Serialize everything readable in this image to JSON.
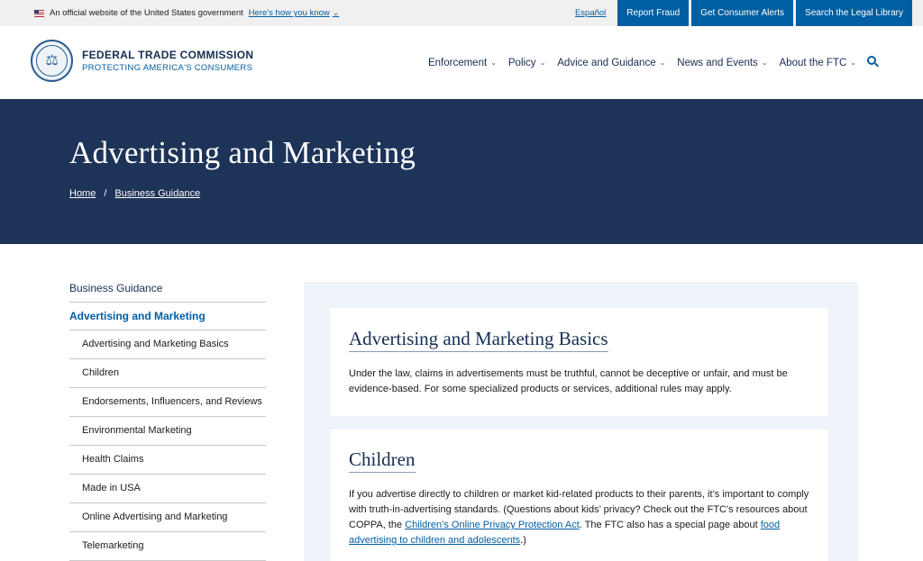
{
  "gov_banner": {
    "official_text": "An official website of the United States government",
    "how_you_know": "Here's how you know",
    "espanol": "Español",
    "buttons": [
      "Report Fraud",
      "Get Consumer Alerts",
      "Search the Legal Library"
    ]
  },
  "header": {
    "org_name": "FEDERAL TRADE COMMISSION",
    "org_tagline": "PROTECTING AMERICA'S CONSUMERS",
    "nav": [
      "Enforcement",
      "Policy",
      "Advice and Guidance",
      "News and Events",
      "About the FTC"
    ]
  },
  "hero": {
    "title": "Advertising and Marketing",
    "breadcrumb": [
      "Home",
      "Business Guidance"
    ],
    "breadcrumb_sep": "/"
  },
  "sidebar": {
    "parent": "Business Guidance",
    "current": "Advertising and Marketing",
    "items": [
      "Advertising and Marketing Basics",
      "Children",
      "Endorsements, Influencers, and Reviews",
      "Environmental Marketing",
      "Health Claims",
      "Made in USA",
      "Online Advertising and Marketing",
      "Telemarketing"
    ]
  },
  "cards": [
    {
      "title": "Advertising and Marketing Basics",
      "text": "Under the law, claims in advertisements must be truthful, cannot be deceptive or unfair, and must be evidence-based. For some specialized products or services, additional rules may apply."
    },
    {
      "title": "Children",
      "text_part1": "If you advertise directly to children or market kid-related products to their parents, it’s important to comply with truth-in-advertising standards. (Questions about kids’ privacy? Check out the FTC's resources about COPPA, the ",
      "link1": "Children’s Online Privacy Protection Act",
      "text_part2": ". The FTC also has a special page about ",
      "link2": "food advertising to children and adolescents",
      "text_part3": ".)"
    }
  ],
  "colors": {
    "hero_bg": "#1e3358",
    "link": "#005ea2",
    "navy_text": "#162e51",
    "content_bg": "#eef4f9"
  },
  "icons": [
    "us-flag-icon",
    "chevron-down-icon",
    "ftc-seal-icon",
    "search-icon"
  ]
}
